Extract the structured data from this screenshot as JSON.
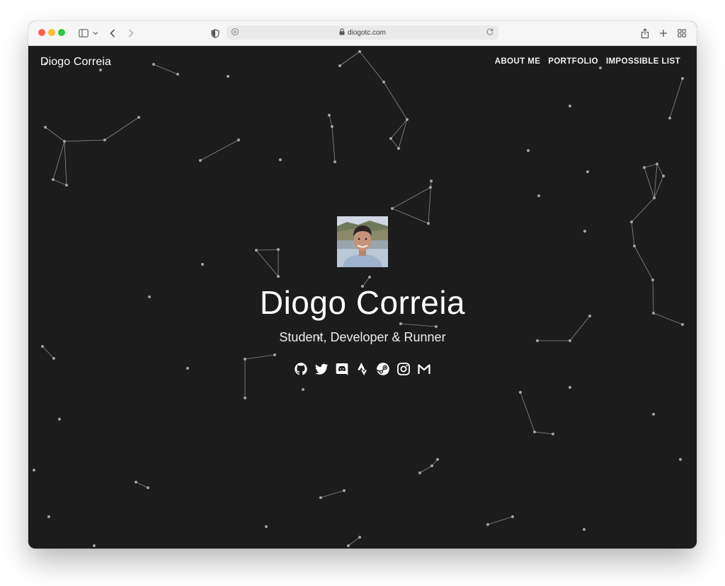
{
  "browser": {
    "url": "diogotc.com",
    "icons": [
      "sidebar-icon",
      "chevron-down-icon",
      "back-icon",
      "forward-icon",
      "shield-icon",
      "lock-icon",
      "reload-icon",
      "share-icon",
      "new-tab-icon",
      "tab-overview-icon"
    ]
  },
  "site": {
    "brand": "Diogo Correia",
    "nav": [
      "ABOUT ME",
      "PORTFOLIO",
      "IMPOSSIBLE LIST"
    ],
    "hero": {
      "title": "Diogo Correia",
      "subtitle": "Student, Developer & Runner"
    },
    "social_icons": [
      "github-icon",
      "twitter-icon",
      "discord-icon",
      "strava-icon",
      "steam-icon",
      "instagram-icon",
      "gmail-icon"
    ]
  },
  "colors": {
    "background": "#1c1c1d",
    "text": "#ffffff",
    "star": "#9a9a9a",
    "star_line": "#8a8a8a"
  }
}
